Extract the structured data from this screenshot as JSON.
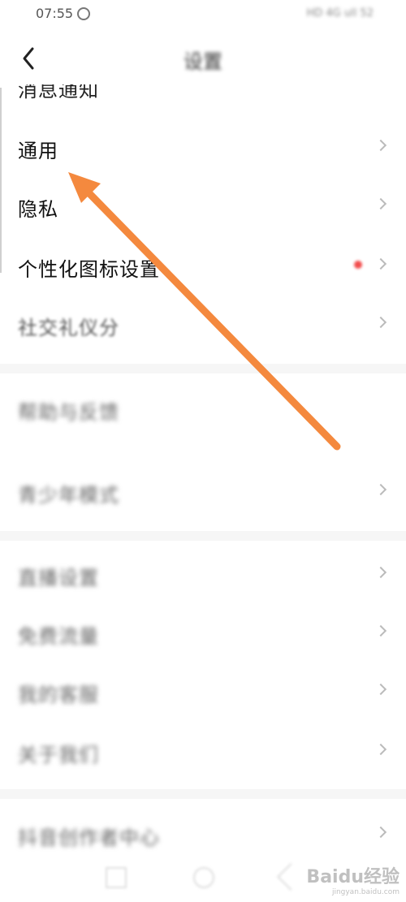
{
  "status": {
    "time": "07:55",
    "system": "HD 4G ull 52"
  },
  "header": {
    "title": "设置"
  },
  "settings": {
    "clipped_item": "消息通知",
    "items": [
      "通用",
      "隐私",
      "个性化图标设置",
      "社交礼仪分"
    ],
    "blurred_items": [
      "帮助与反馈",
      "青少年模式",
      "直播设置",
      "免费流量",
      "我的客服",
      "关于我们",
      "抖音创作者中心"
    ]
  },
  "watermark": {
    "brand": "Baidu经验",
    "url": "jingyan.baidu.com"
  },
  "colors": {
    "arrow": "#F4893E",
    "notification_dot": "#F24D4D"
  }
}
